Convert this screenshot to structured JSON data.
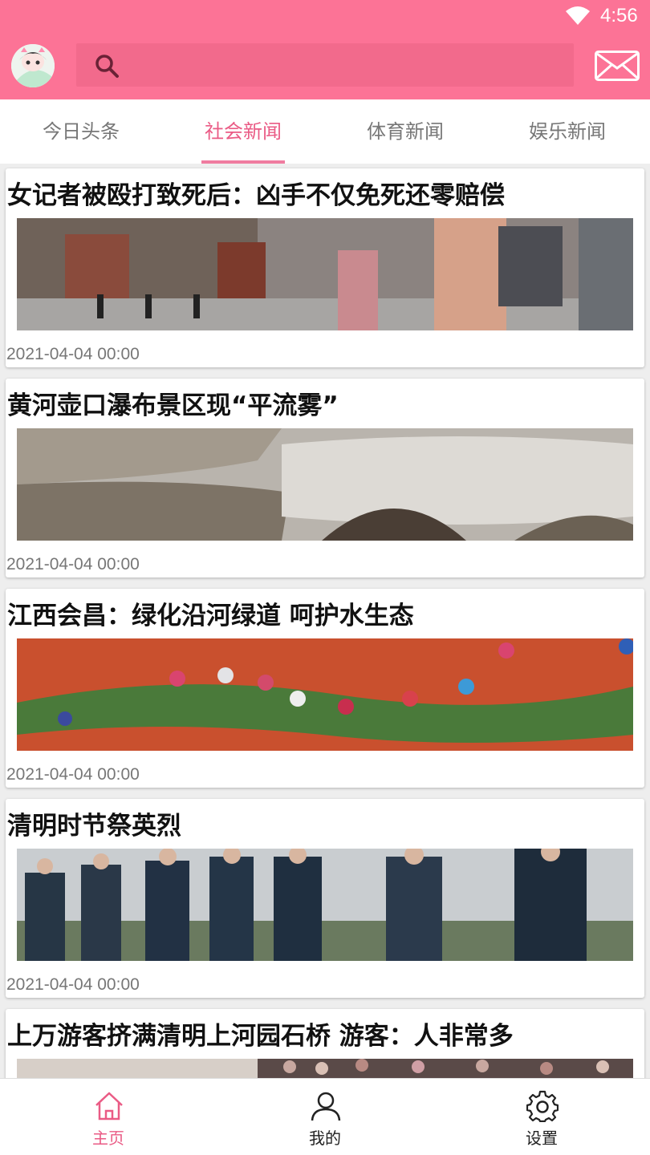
{
  "status_bar": {
    "time": "4:56"
  },
  "header": {
    "search_placeholder": ""
  },
  "tabs": [
    {
      "label": "今日头条"
    },
    {
      "label": "社会新闻"
    },
    {
      "label": "体育新闻"
    },
    {
      "label": "娱乐新闻"
    }
  ],
  "active_tab": "社会新闻",
  "articles": [
    {
      "title": "女记者被殴打致死后：凶手不仅免死还零赔偿",
      "date": "2021-04-04 00:00"
    },
    {
      "title": "黄河壶口瀑布景区现“平流雾”",
      "date": "2021-04-04 00:00"
    },
    {
      "title": "江西会昌：绿化沿河绿道 呵护水生态",
      "date": "2021-04-04 00:00"
    },
    {
      "title": "清明时节祭英烈",
      "date": "2021-04-04 00:00"
    },
    {
      "title": "上万游客挤满清明上河园石桥 游客：人非常多",
      "date": ""
    }
  ],
  "bottom_nav": [
    {
      "label": "主页",
      "icon": "home-icon"
    },
    {
      "label": "我的",
      "icon": "user-icon"
    },
    {
      "label": "设置",
      "icon": "settings-icon"
    }
  ],
  "colors": {
    "brand": "#fc7396",
    "accent": "#ea5b85"
  }
}
